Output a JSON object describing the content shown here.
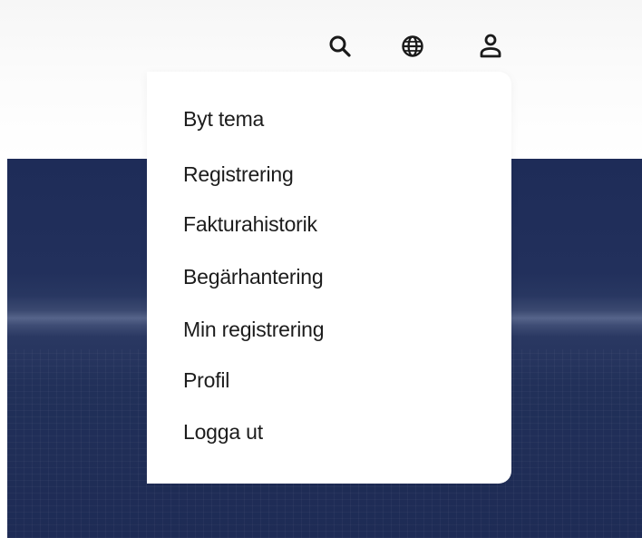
{
  "header": {
    "icons": {
      "search": "search-icon",
      "language": "globe-icon",
      "account": "user-icon"
    },
    "icon_color": "#1a1a1a"
  },
  "hero": {
    "background_color": "#1e2c58"
  },
  "menu": {
    "items": [
      {
        "label": "Byt tema"
      },
      {
        "label": "Registrering"
      },
      {
        "label": "Fakturahistorik"
      },
      {
        "label": "Begärhantering"
      },
      {
        "label": "Min registrering"
      },
      {
        "label": "Profil"
      },
      {
        "label": "Logga ut"
      }
    ]
  }
}
